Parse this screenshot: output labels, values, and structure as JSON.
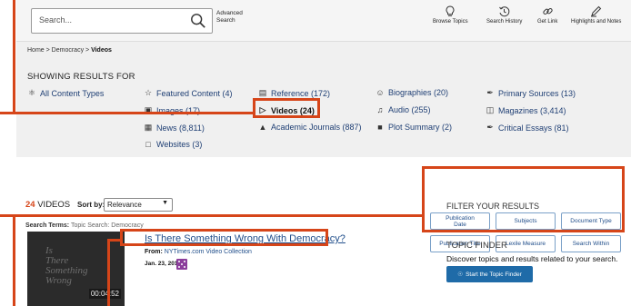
{
  "header": {
    "search_placeholder": "Search...",
    "advanced_search": "Advanced\nSearch",
    "tools": [
      {
        "label": "Browse Topics",
        "icon": "lightbulb-icon"
      },
      {
        "label": "Search History",
        "icon": "history-icon"
      },
      {
        "label": "Get Link",
        "icon": "link-icon"
      },
      {
        "label": "Highlights and Notes",
        "icon": "pen-icon"
      }
    ]
  },
  "breadcrumb": {
    "home": "Home",
    "sep1": " > ",
    "democracy": "Democracy",
    "sep2": " > ",
    "current": "Videos"
  },
  "results": {
    "heading": "SHOWING RESULTS FOR",
    "content_types": [
      {
        "label": "All Content Types",
        "icon": "globe-icon"
      },
      {
        "label": "Featured Content  (4)",
        "icon": "star-icon"
      },
      {
        "label": "Reference  (172)",
        "icon": "reference-icon"
      },
      {
        "label": "Biographies  (20)",
        "icon": "person-icon"
      },
      {
        "label": "Primary Sources  (13)",
        "icon": "quill-icon"
      },
      {
        "label": "Images  (17)",
        "icon": "image-icon"
      },
      {
        "label": "Videos  (24)",
        "icon": "play-icon"
      },
      {
        "label": "Audio  (255)",
        "icon": "audio-icon"
      },
      {
        "label": "Magazines  (3,414)",
        "icon": "magazine-icon"
      },
      {
        "label": "News  (8,811)",
        "icon": "news-icon"
      },
      {
        "label": "Academic Journals  (887)",
        "icon": "graduation-cap-icon"
      },
      {
        "label": "Plot Summary  (2)",
        "icon": "document-icon"
      },
      {
        "label": "Critical Essays  (81)",
        "icon": "quill-icon"
      },
      {
        "label": "Websites  (3)",
        "icon": "window-icon"
      }
    ]
  },
  "listing": {
    "count": "24",
    "count_label": " VIDEOS",
    "sort_by_label": "Sort by:",
    "sort_value": "Relevance",
    "search_terms_label": "Search Terms:",
    "search_terms_value": "Topic Search: Democracy"
  },
  "filter": {
    "title": "FILTER YOUR RESULTS",
    "buttons": [
      "Publication\nDate",
      "Subjects",
      "Document Type",
      "Publication Title",
      "Lexile Measure",
      "Search Within"
    ]
  },
  "video": {
    "title": "Is There Something Wrong With Democracy?",
    "from_label": "From:",
    "source": "NYTimes.com Video Collection",
    "date": "Jan. 23, 2018",
    "duration": "00:04:52",
    "thumb_text": "Is\nThere\nSomething\nWrong"
  },
  "topic_finder": {
    "title": "TOPIC FINDER",
    "description": "Discover topics and results related to your search.",
    "button": "Start the Topic Finder"
  },
  "colors": {
    "annotation": "#d64519",
    "link": "#1f4d8a",
    "button_blue": "#1f6ba8",
    "media_badge": "#8c3e9c"
  }
}
